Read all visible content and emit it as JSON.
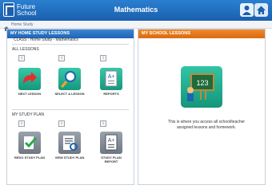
{
  "header": {
    "logo_line1": "Future",
    "logo_line2": "School",
    "title": "Mathematics",
    "user_icon": "user-icon",
    "home_icon": "home-icon"
  },
  "breadcrumb": {
    "home_icon": "home-icon",
    "text": "Home Study"
  },
  "left_panel": {
    "title": "MY HOME STUDY LESSONS",
    "class_line": "CLASS : Home Study - Mathematics",
    "all_lessons_label": "ALL LESSONS",
    "tiles_row1": [
      {
        "label": "NEXT LESSON",
        "icon": "red-arrow-icon"
      },
      {
        "label": "SELECT A LESSON",
        "icon": "magnifier-icon"
      },
      {
        "label": "REPORTS",
        "icon": "report-icon"
      }
    ],
    "study_plan_label": "MY STUDY PLAN",
    "tiles_row2": [
      {
        "label": "REDO STUDY PLAN",
        "icon": "redo-icon"
      },
      {
        "label": "VIEW STUDY PLAN",
        "icon": "view-plan-icon"
      },
      {
        "label": "STUDY PLAN REPORT",
        "icon": "plan-report-icon"
      }
    ],
    "info_symbol": "i"
  },
  "right_panel": {
    "title": "MY SCHOOL LESSONS",
    "description": "This is where you access all school/teacher assigned lessons and homework.",
    "icon": "chalkboard-icon"
  }
}
